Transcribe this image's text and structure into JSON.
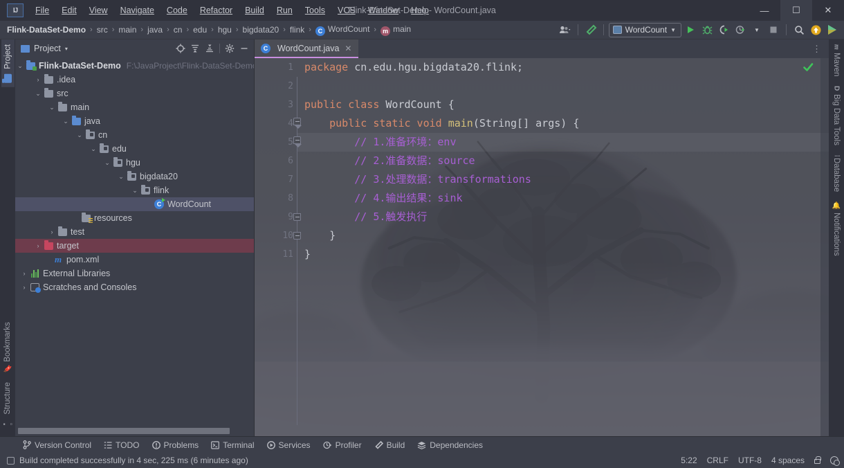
{
  "window": {
    "title": "Flink-DataSet-Demo - WordCount.java",
    "minimize": "—",
    "maximize": "☐",
    "close": "✕",
    "logo": "IJ"
  },
  "menu": {
    "items": [
      {
        "label": "File",
        "mnemonic": "F"
      },
      {
        "label": "Edit",
        "mnemonic": "E"
      },
      {
        "label": "View",
        "mnemonic": "V"
      },
      {
        "label": "Navigate",
        "mnemonic": "N"
      },
      {
        "label": "Code",
        "mnemonic": "C"
      },
      {
        "label": "Refactor",
        "mnemonic": "R"
      },
      {
        "label": "Build",
        "mnemonic": "B"
      },
      {
        "label": "Run",
        "mnemonic": "n"
      },
      {
        "label": "Tools",
        "mnemonic": "T"
      },
      {
        "label": "VCS",
        "mnemonic": "S"
      },
      {
        "label": "Window",
        "mnemonic": "W"
      },
      {
        "label": "Help",
        "mnemonic": "H"
      }
    ]
  },
  "navbar": {
    "breadcrumbs": [
      {
        "label": "Flink-DataSet-Demo",
        "icon": "",
        "root": true
      },
      {
        "label": "src",
        "icon": ""
      },
      {
        "label": "main",
        "icon": ""
      },
      {
        "label": "java",
        "icon": ""
      },
      {
        "label": "cn",
        "icon": ""
      },
      {
        "label": "edu",
        "icon": ""
      },
      {
        "label": "hgu",
        "icon": ""
      },
      {
        "label": "bigdata20",
        "icon": ""
      },
      {
        "label": "flink",
        "icon": ""
      },
      {
        "label": "WordCount",
        "icon": "class-icon",
        "badge": "C"
      },
      {
        "label": "main",
        "icon": "method-icon",
        "badge": "m"
      }
    ],
    "separator": "›",
    "toolbar": {
      "account_icon": "account-icon",
      "build_icon": "build-hammer-icon",
      "run_config": "WordCount",
      "run_icon": "run-icon",
      "debug_icon": "debug-icon",
      "run_coverage_icon": "run-with-coverage-icon",
      "profile_icon": "profiler-icon",
      "stop_icon": "stop-icon",
      "search_icon": "search-everywhere-icon",
      "update_icon": "update-project-icon",
      "ide_icon": "ide-icon"
    }
  },
  "left_strip": {
    "top": [
      {
        "label": "Project",
        "icon": "project-folder-icon",
        "active": true
      }
    ],
    "bottom": [
      {
        "label": "Bookmarks",
        "icon": "bookmark-icon"
      },
      {
        "label": "Structure",
        "icon": "structure-icon"
      }
    ]
  },
  "right_strip": {
    "items": [
      {
        "label": "Maven",
        "icon": "maven-m-icon"
      },
      {
        "label": "Big Data Tools",
        "icon": "big-data-d-icon"
      },
      {
        "label": "Database",
        "icon": "database-icon"
      },
      {
        "label": "Notifications",
        "icon": "notifications-bell-icon"
      }
    ]
  },
  "project_panel": {
    "title": "Project",
    "dropdown_caret": "▾",
    "actions": [
      {
        "name": "select-opened-file-icon",
        "label": "⊕"
      },
      {
        "name": "expand-all-icon",
        "label": "≡"
      },
      {
        "name": "collapse-all-icon",
        "label": "≡"
      },
      {
        "name": "settings-gear-icon",
        "label": "⚙"
      },
      {
        "name": "hide-panel-icon",
        "label": "—"
      }
    ],
    "tree": [
      {
        "label": "Flink-DataSet-Demo",
        "path": "F:\\JavaProject\\Flink-DataSet-Demo",
        "indent": 0,
        "arrow": "⌄",
        "icon": "project-root-folder",
        "bold": true
      },
      {
        "label": ".idea",
        "indent": 1,
        "arrow": "›",
        "icon": "folder"
      },
      {
        "label": "src",
        "indent": 1,
        "arrow": "⌄",
        "icon": "folder"
      },
      {
        "label": "main",
        "indent": 2,
        "arrow": "⌄",
        "icon": "folder"
      },
      {
        "label": "java",
        "indent": 3,
        "arrow": "⌄",
        "icon": "source-folder"
      },
      {
        "label": "cn",
        "indent": 4,
        "arrow": "⌄",
        "icon": "package-folder"
      },
      {
        "label": "edu",
        "indent": 5,
        "arrow": "⌄",
        "icon": "package-folder"
      },
      {
        "label": "hgu",
        "indent": 6,
        "arrow": "⌄",
        "icon": "package-folder"
      },
      {
        "label": "bigdata20",
        "indent": 7,
        "arrow": "⌄",
        "icon": "package-folder"
      },
      {
        "label": "flink",
        "indent": 8,
        "arrow": "⌄",
        "icon": "package-folder"
      },
      {
        "label": "WordCount",
        "indent": 9,
        "arrow": "",
        "icon": "java-class-runnable",
        "selected": true
      },
      {
        "label": "resources",
        "indent": 3,
        "arrow": "",
        "icon": "resources-folder"
      },
      {
        "label": "test",
        "indent": 2,
        "arrow": "›",
        "icon": "folder"
      },
      {
        "label": "target",
        "indent": 1,
        "arrow": "›",
        "icon": "excluded-folder",
        "error": true
      },
      {
        "label": "pom.xml",
        "indent": 1,
        "arrow": "",
        "icon": "maven-file"
      },
      {
        "label": "External Libraries",
        "indent": 0,
        "arrow": "›",
        "icon": "libraries"
      },
      {
        "label": "Scratches and Consoles",
        "indent": 0,
        "arrow": "›",
        "icon": "scratches"
      }
    ]
  },
  "editor": {
    "tab": {
      "label": "WordCount.java",
      "icon": "java-class-icon",
      "badge": "C",
      "close": "✕"
    },
    "more_options": "⋮",
    "inspection_status": "ok-checkmark",
    "lines": [
      {
        "n": "1",
        "tokens": [
          {
            "t": "package ",
            "c": "kw"
          },
          {
            "t": "cn.edu.hgu.bigdata20.flink;",
            "c": "id"
          }
        ],
        "indent": 0
      },
      {
        "n": "2",
        "tokens": [],
        "indent": 0
      },
      {
        "n": "3",
        "tokens": [
          {
            "t": "public class ",
            "c": "kw"
          },
          {
            "t": "WordCount ",
            "c": "id"
          },
          {
            "t": "{",
            "c": "punct"
          }
        ],
        "indent": 0,
        "runmark": true
      },
      {
        "n": "4",
        "tokens": [
          {
            "t": "public static void ",
            "c": "kw"
          },
          {
            "t": "main",
            "c": "mth"
          },
          {
            "t": "(String[] args) {",
            "c": "id"
          }
        ],
        "indent": 1,
        "runmark": true,
        "fold": "top"
      },
      {
        "n": "5",
        "tokens": [
          {
            "t": "// 1.准备环境：env",
            "c": "cmt"
          }
        ],
        "indent": 2,
        "highlight": true,
        "fold": "top2"
      },
      {
        "n": "6",
        "tokens": [
          {
            "t": "// 2.准备数据：source",
            "c": "cmt"
          }
        ],
        "indent": 2
      },
      {
        "n": "7",
        "tokens": [
          {
            "t": "// 3.处理数据：transformations",
            "c": "cmt"
          }
        ],
        "indent": 2
      },
      {
        "n": "8",
        "tokens": [
          {
            "t": "// 4.输出结果：sink",
            "c": "cmt"
          }
        ],
        "indent": 2
      },
      {
        "n": "9",
        "tokens": [
          {
            "t": "// 5.触发执行",
            "c": "cmt"
          }
        ],
        "indent": 2,
        "fold": "bot"
      },
      {
        "n": "10",
        "tokens": [
          {
            "t": "}",
            "c": "punct"
          }
        ],
        "indent": 1,
        "fold": "bot"
      },
      {
        "n": "11",
        "tokens": [
          {
            "t": "}",
            "c": "punct"
          }
        ],
        "indent": 0
      }
    ]
  },
  "tool_windows": [
    {
      "label": "Version Control",
      "icon": "branch-icon"
    },
    {
      "label": "TODO",
      "icon": "todo-list-icon"
    },
    {
      "label": "Problems",
      "icon": "problems-icon"
    },
    {
      "label": "Terminal",
      "icon": "terminal-icon"
    },
    {
      "label": "Services",
      "icon": "services-icon"
    },
    {
      "label": "Profiler",
      "icon": "profiler-icon"
    },
    {
      "label": "Build",
      "icon": "build-hammer-icon"
    },
    {
      "label": "Dependencies",
      "icon": "dependencies-icon"
    }
  ],
  "status_bar": {
    "message": "Build completed successfully in 4 sec, 225 ms (6 minutes ago)",
    "message_icon": "event-log-icon",
    "caret_position": "5:22",
    "line_separator": "CRLF",
    "encoding": "UTF-8",
    "indent": "4 spaces",
    "lock_icon": "read-only-lock-icon",
    "settings_icon": "ide-settings-icon"
  },
  "colors": {
    "accent_tab": "#c98ee0",
    "run_green": "#46c05a",
    "error_red": "#6e3c4c",
    "selection": "#4e5167",
    "titlebar": "#30323c",
    "panel": "#3c3f4a",
    "editor": "#4b4d55",
    "comment_purple": "#a85fd4",
    "keyword_orange": "#d98a6a"
  }
}
